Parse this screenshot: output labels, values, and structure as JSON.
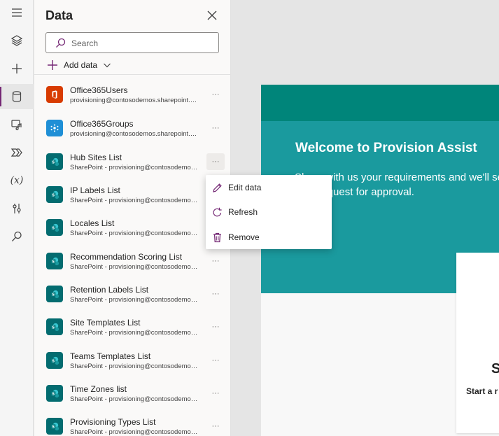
{
  "panel": {
    "title": "Data",
    "search_placeholder": "Search",
    "add_data_label": "Add data"
  },
  "sources": [
    {
      "name": "Office365Users",
      "sub": "provisioning@contosodemos.sharepoint.com",
      "icon": "office-icon"
    },
    {
      "name": "Office365Groups",
      "sub": "provisioning@contosodemos.sharepoint.com",
      "icon": "groups-icon"
    },
    {
      "name": "Hub Sites List",
      "sub": "SharePoint - provisioning@contosodemos.sharepoint.com",
      "icon": "sharepoint-icon"
    },
    {
      "name": "IP Labels List",
      "sub": "SharePoint - provisioning@contosodemos.sharepoint.com",
      "icon": "sharepoint-icon"
    },
    {
      "name": "Locales List",
      "sub": "SharePoint - provisioning@contosodemos.sharepoint.com",
      "icon": "sharepoint-icon"
    },
    {
      "name": "Recommendation Scoring List",
      "sub": "SharePoint - provisioning@contosodemos.sharepoint.com",
      "icon": "sharepoint-icon"
    },
    {
      "name": "Retention Labels List",
      "sub": "SharePoint - provisioning@contosodemos.sharepoint.com",
      "icon": "sharepoint-icon"
    },
    {
      "name": "Site Templates List",
      "sub": "SharePoint - provisioning@contosodemos.sharepoint.com",
      "icon": "sharepoint-icon"
    },
    {
      "name": "Teams Templates List",
      "sub": "SharePoint - provisioning@contosodemos.sharepoint.com",
      "icon": "sharepoint-icon"
    },
    {
      "name": "Time Zones list",
      "sub": "SharePoint - provisioning@contosodemos.sharepoint.com",
      "icon": "sharepoint-icon"
    },
    {
      "name": "Provisioning Types List",
      "sub": "SharePoint - provisioning@contosodemos.sharepoint.com",
      "icon": "sharepoint-icon"
    }
  ],
  "more_label": "···",
  "context_menu": {
    "items": [
      {
        "label": "Edit data",
        "icon": "pencil-icon"
      },
      {
        "label": "Refresh",
        "icon": "refresh-icon"
      },
      {
        "label": "Remove",
        "icon": "trash-icon"
      }
    ]
  },
  "canvas": {
    "title": "Welcome to Provision Assist",
    "description": "Share with us your requirements and we'll send your request for approval.",
    "card_title": "S",
    "card_subtitle": "Start a r"
  },
  "rail": {
    "fx_label": "(x)"
  },
  "colors": {
    "accent": "#742774",
    "office_red": "#d83b01",
    "groups_blue": "#1f8fd6",
    "sharepoint_teal": "#036c70",
    "header_teal": "#00857a",
    "hero_teal": "#1a9a9e"
  }
}
